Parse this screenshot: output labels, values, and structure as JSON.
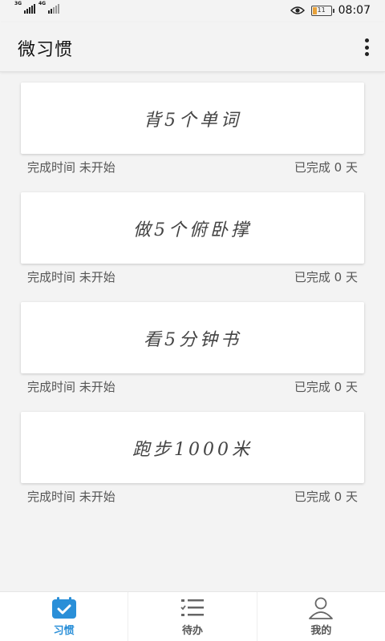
{
  "status_bar": {
    "network_1": "3G",
    "network_2": "4G",
    "battery_level": "11",
    "time": "08:07"
  },
  "app_bar": {
    "title": "微习惯",
    "menu_icon": "more-vertical-icon"
  },
  "habits": [
    {
      "name": "背5个单词",
      "time_label": "完成时间",
      "time_value": "未开始",
      "done_label": "已完成",
      "done_days": "0",
      "days_unit": "天"
    },
    {
      "name": "做5个俯卧撑",
      "time_label": "完成时间",
      "time_value": "未开始",
      "done_label": "已完成",
      "done_days": "0",
      "days_unit": "天"
    },
    {
      "name": "看5分钟书",
      "time_label": "完成时间",
      "time_value": "未开始",
      "done_label": "已完成",
      "done_days": "0",
      "days_unit": "天"
    },
    {
      "name": "跑步1000米",
      "time_label": "完成时间",
      "time_value": "未开始",
      "done_label": "已完成",
      "done_days": "0",
      "days_unit": "天"
    }
  ],
  "bottom_nav": [
    {
      "label": "习惯",
      "icon": "calendar-check-icon",
      "active": true
    },
    {
      "label": "待办",
      "icon": "checklist-icon",
      "active": false
    },
    {
      "label": "我的",
      "icon": "person-icon",
      "active": false
    }
  ],
  "colors": {
    "accent": "#2a8fd8",
    "background": "#f3f3f3",
    "battery": "#e8a23a"
  }
}
